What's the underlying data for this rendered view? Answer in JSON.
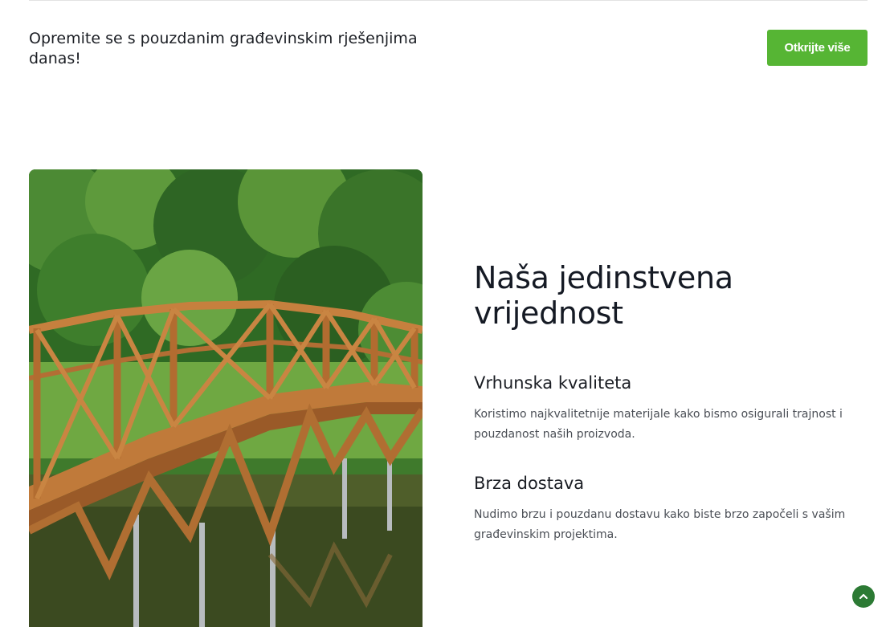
{
  "cta": {
    "text": "Opremite se s pouzdanim građevinskim rješenjima danas!",
    "button_label": "Otkrijte više"
  },
  "values": {
    "title": "Naša jedinstvena vrijednost",
    "features": [
      {
        "title": "Vrhunska kvaliteta",
        "description": "Koristimo najkvalitetnije materijale kako bismo osigurali trajnost i pouzdanost naših proizvoda."
      },
      {
        "title": "Brza dostava",
        "description": "Nudimo brzu i pouzdanu dostavu kako biste brzo započeli s vašim građevinskim projektima."
      }
    ]
  },
  "icons": {
    "scroll_top": "chevron-up-icon"
  },
  "colors": {
    "accent": "#56b534",
    "scroll_button": "#2c7a34",
    "heading": "#151a24",
    "body_text": "#4a4e55"
  }
}
